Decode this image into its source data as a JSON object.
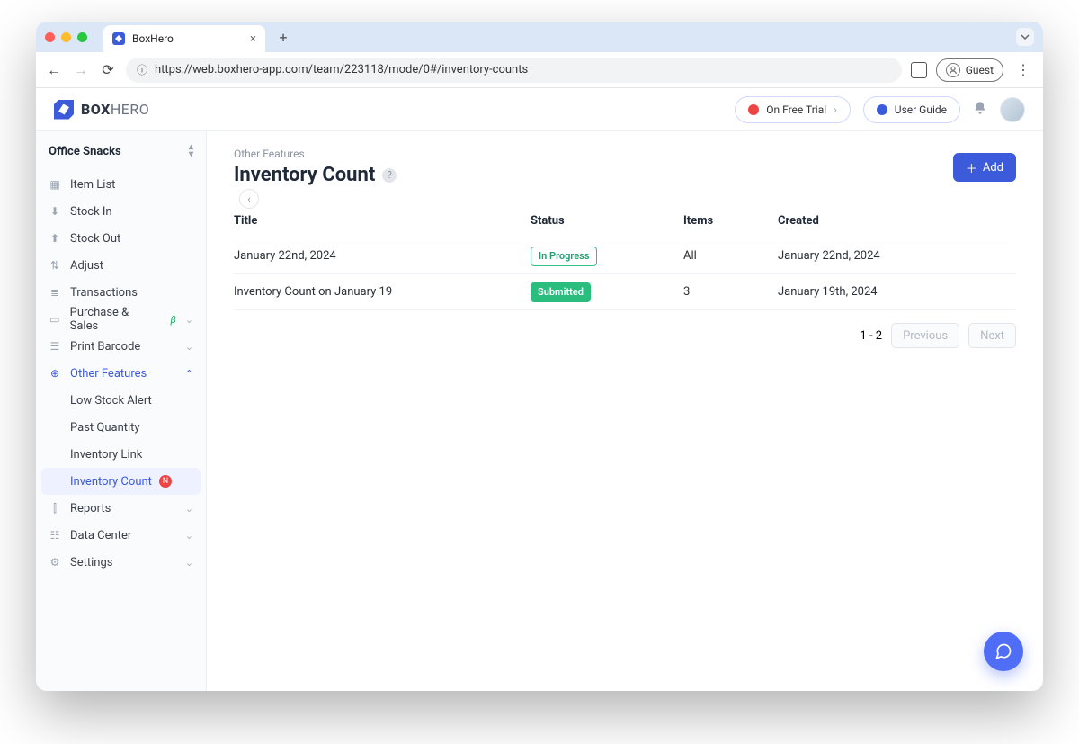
{
  "browser": {
    "tab_title": "BoxHero",
    "url": "https://web.boxhero-app.com/team/223118/mode/0#/inventory-counts",
    "guest_label": "Guest"
  },
  "header": {
    "logo_box": "BOX",
    "logo_hero": "HERO",
    "trial_label": "On Free Trial",
    "guide_label": "User Guide"
  },
  "sidebar": {
    "team": "Office Snacks",
    "items": [
      {
        "label": "Item List"
      },
      {
        "label": "Stock In"
      },
      {
        "label": "Stock Out"
      },
      {
        "label": "Adjust"
      },
      {
        "label": "Transactions"
      },
      {
        "label": "Purchase & Sales"
      },
      {
        "label": "Print Barcode"
      },
      {
        "label": "Other Features"
      },
      {
        "label": "Reports"
      },
      {
        "label": "Data Center"
      },
      {
        "label": "Settings"
      }
    ],
    "beta_marker": "β",
    "subitems": [
      {
        "label": "Low Stock Alert"
      },
      {
        "label": "Past Quantity"
      },
      {
        "label": "Inventory Link"
      },
      {
        "label": "Inventory Count"
      }
    ],
    "new_badge": "N"
  },
  "main": {
    "breadcrumb": "Other Features",
    "title": "Inventory Count",
    "add_label": "Add",
    "columns": {
      "title": "Title",
      "status": "Status",
      "items": "Items",
      "created": "Created"
    },
    "rows": [
      {
        "title": "January 22nd, 2024",
        "status": "In Progress",
        "status_kind": "inprog",
        "items": "All",
        "created": "January 22nd, 2024"
      },
      {
        "title": "Inventory Count on January 19",
        "status": "Submitted",
        "status_kind": "subm",
        "items": "3",
        "created": "January 19th, 2024"
      }
    ],
    "pager": {
      "range": "1 - 2",
      "prev": "Previous",
      "next": "Next"
    }
  }
}
